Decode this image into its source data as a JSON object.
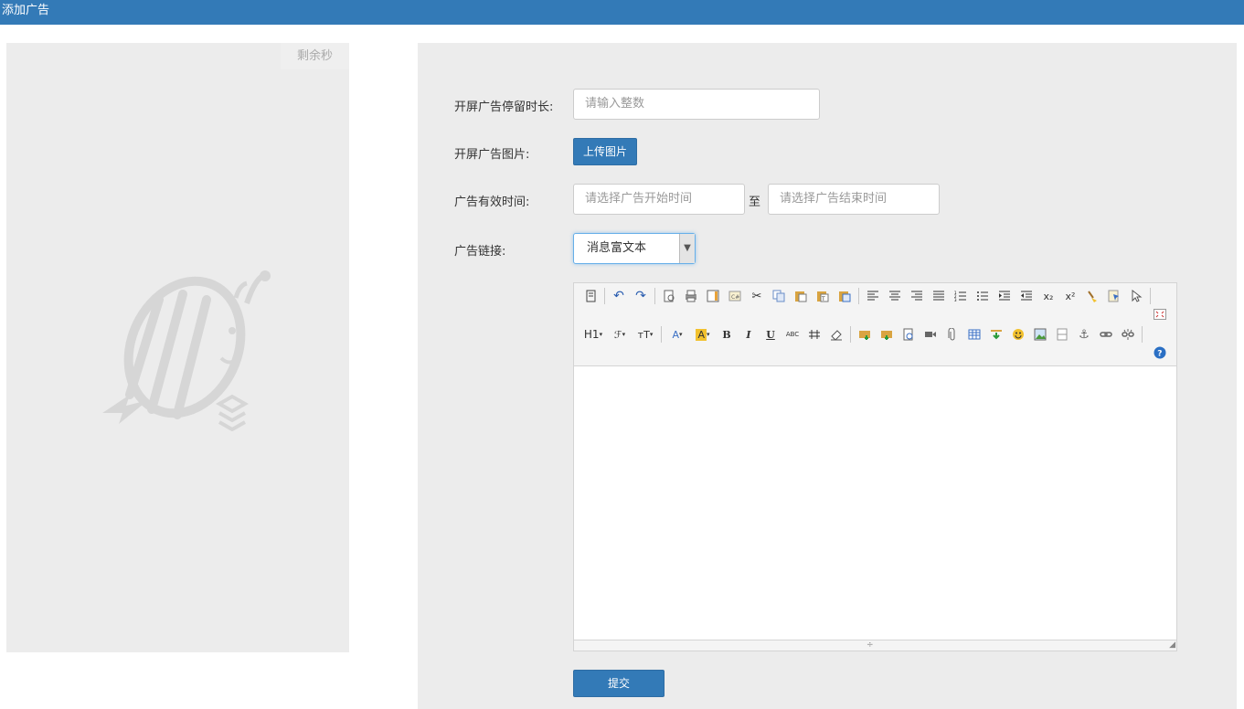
{
  "header": {
    "title": "添加广告"
  },
  "preview": {
    "skip_label": "剩余秒"
  },
  "form": {
    "duration": {
      "label": "开屏广告停留时长:",
      "placeholder": "请输入整数"
    },
    "image": {
      "label": "开屏广告图片:",
      "upload_label": "上传图片"
    },
    "period": {
      "label": "广告有效时间:",
      "start_placeholder": "请选择广告开始时间",
      "separator": "至",
      "end_placeholder": "请选择广告结束时间"
    },
    "link": {
      "label": "广告链接:",
      "selected": "消息富文本"
    },
    "submit_label": "提交"
  },
  "editor": {
    "row1": {
      "font_color": "A",
      "bgcolor": "A",
      "heading": "H1",
      "fontfamily": "ℱ",
      "fontsize": "тT",
      "bold": "B",
      "italic": "I",
      "underline": "U",
      "strike": "ABC",
      "sub": "x₂",
      "sup": "x²"
    }
  }
}
